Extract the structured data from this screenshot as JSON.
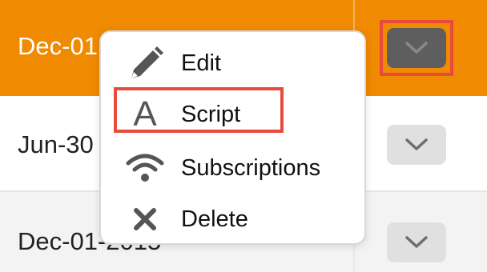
{
  "rows": [
    {
      "date": "Dec-01",
      "selected": true
    },
    {
      "date": "Jun-30",
      "selected": false
    },
    {
      "date": "Dec-01-2015",
      "selected": false
    }
  ],
  "dropdown_icon": "chevron-down-icon",
  "menu": {
    "items": [
      {
        "label": "Edit",
        "icon": "pencil-icon"
      },
      {
        "label": "Script",
        "icon": "letter-a-icon",
        "glyph": "A"
      },
      {
        "label": "Subscriptions",
        "icon": "wifi-icon"
      },
      {
        "label": "Delete",
        "icon": "close-icon"
      }
    ]
  },
  "colors": {
    "selected_row": "#f08a00",
    "highlight": "#e84a3c",
    "active_button": "#5e5e5e",
    "button": "#e0e0e0"
  }
}
